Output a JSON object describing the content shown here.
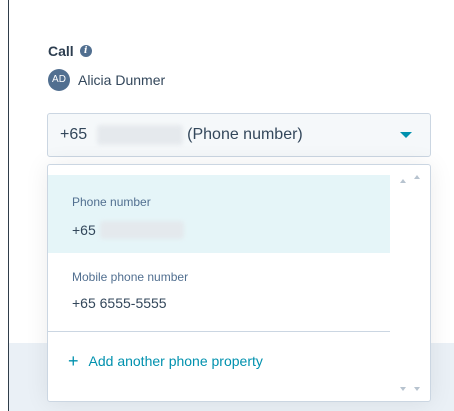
{
  "call": {
    "title": "Call",
    "info_icon": "info-icon"
  },
  "contact": {
    "initials": "AD",
    "name": "Alicia Dunmer"
  },
  "phone_select": {
    "country_code": "+65",
    "suffix": "(Phone number)",
    "caret_icon": "caret-down-icon"
  },
  "dropdown": {
    "options": [
      {
        "label": "Phone number",
        "value": "+65",
        "selected": true
      },
      {
        "label": "Mobile phone number",
        "value": "+65 6555-5555",
        "selected": false
      }
    ],
    "add_label": "Add another phone property",
    "add_icon": "plus-icon"
  },
  "colors": {
    "accent": "#0091ae",
    "selected_bg": "#e5f5f8",
    "avatar_bg": "#516f90",
    "text": "#33475b"
  }
}
